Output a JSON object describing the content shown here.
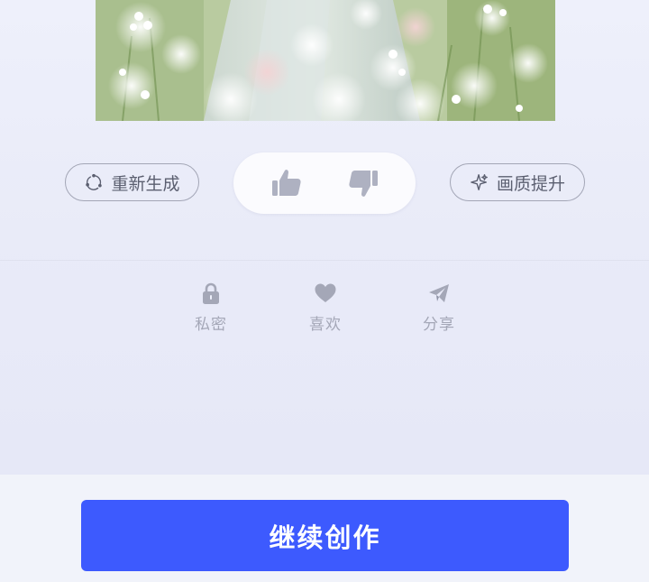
{
  "preview": {
    "description_icon": "generated-image"
  },
  "actions": {
    "regenerate_label": "重新生成",
    "regenerate_icon": "refresh-icon",
    "enhance_label": "画质提升",
    "enhance_icon": "sparkle-icon",
    "thumb_up_icon": "thumb-up-icon",
    "thumb_down_icon": "thumb-down-icon"
  },
  "secondary": {
    "private_label": "私密",
    "like_label": "喜欢",
    "share_label": "分享"
  },
  "bottom": {
    "continue_label": "继续创作"
  },
  "colors": {
    "primary": "#3d5afe",
    "icon_gray": "#a4a7b7",
    "background": "#eef0fb"
  }
}
